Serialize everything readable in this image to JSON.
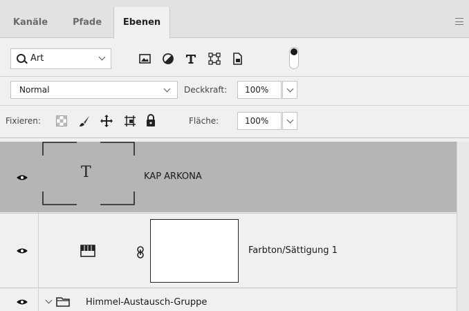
{
  "tabs": [
    {
      "label": "Kanäle"
    },
    {
      "label": "Pfade"
    },
    {
      "label": "Ebenen"
    }
  ],
  "filter": {
    "kind_label": "Art",
    "icons": [
      "pixel-layer-filter-icon",
      "adjustment-layer-filter-icon",
      "type-layer-filter-icon",
      "shape-layer-filter-icon",
      "smart-object-filter-icon",
      "filter-toggle-switch"
    ]
  },
  "blend": {
    "mode": "Normal",
    "opacity_label": "Deckkraft:",
    "opacity_value": "100%"
  },
  "lock": {
    "label": "Fixieren:",
    "icons": [
      "lock-transparent-pixels-icon",
      "lock-image-pixels-icon",
      "lock-position-icon",
      "lock-artboard-icon",
      "lock-all-icon"
    ],
    "fill_label": "Fläche:",
    "fill_value": "100%"
  },
  "layers": [
    {
      "name": "KAP ARKONA",
      "type": "text",
      "thumb_glyph": "T",
      "visible": true,
      "selected": true
    },
    {
      "name": "Farbton/Sättigung 1",
      "type": "adjustment",
      "visible": true,
      "selected": false
    },
    {
      "name": "Himmel-Austausch-Gruppe",
      "type": "group",
      "visible": true,
      "selected": false
    }
  ],
  "colors": {
    "panel_bg": "#f0f0f0",
    "selected_layer": "#b5b5b5",
    "tab_bar": "#e2e2e2"
  }
}
